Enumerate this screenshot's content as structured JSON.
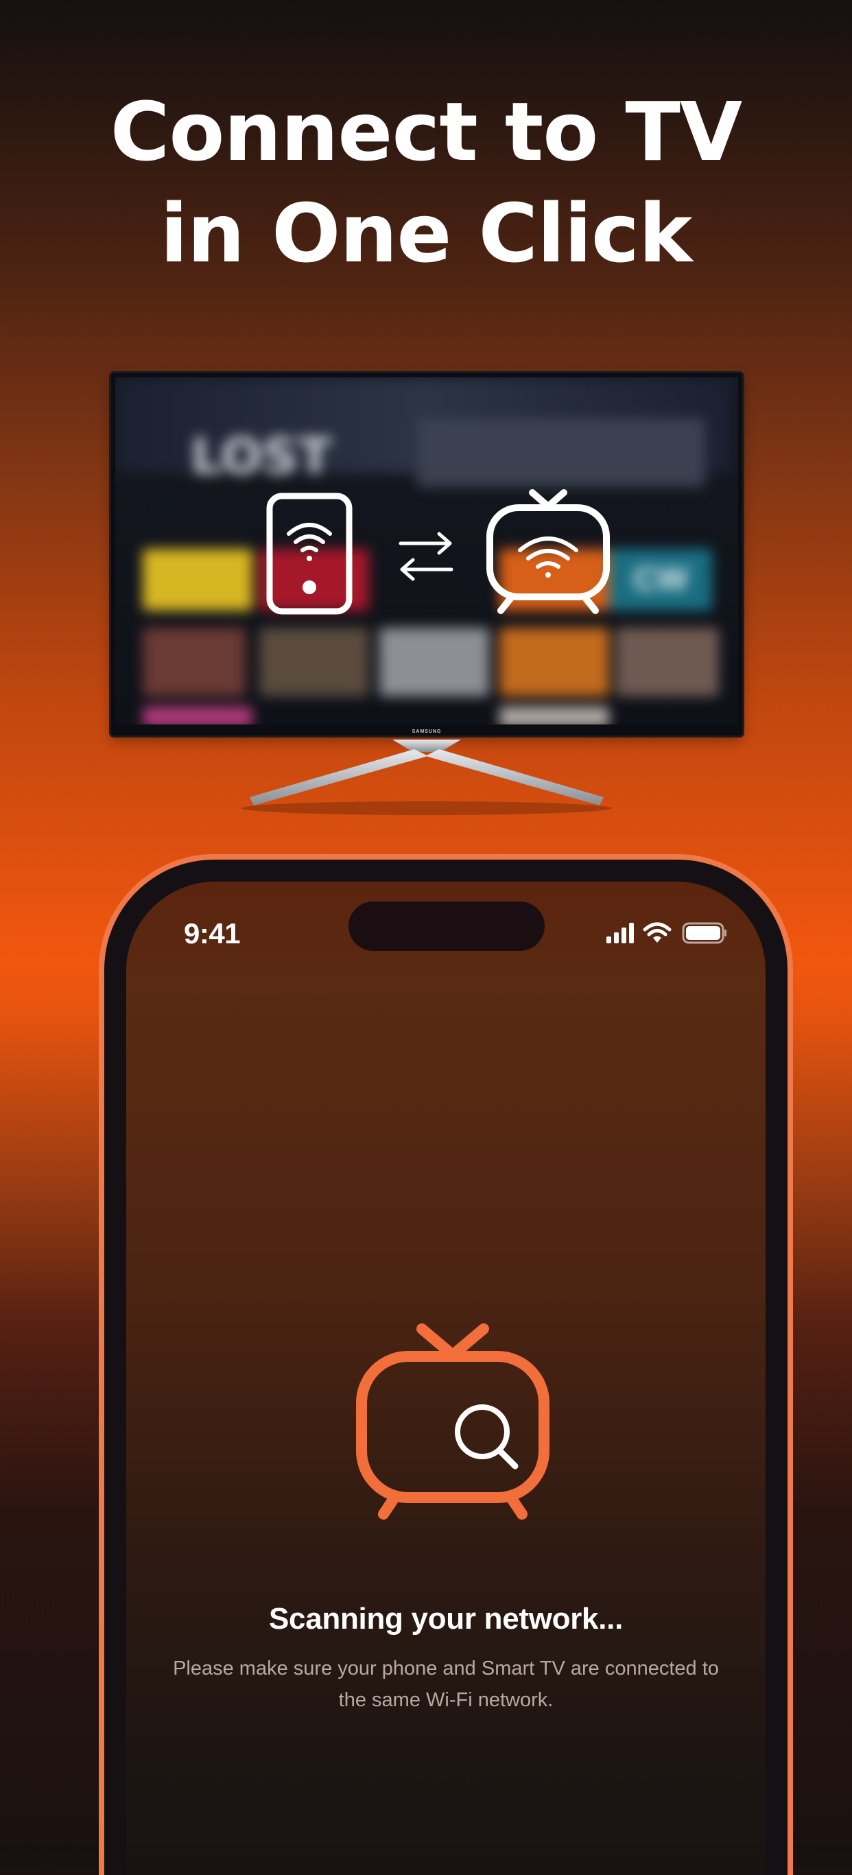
{
  "headline": {
    "line1": "Connect to TV",
    "line2": "in One Click"
  },
  "tv_promo": {
    "brand": "SAMSUNG",
    "blurred_show_title": "LOST",
    "blurred_channel_badge": "CW",
    "phone_icon": "phone-wifi-icon",
    "arrows_icon": "swap-arrows-icon",
    "tv_icon": "tv-wifi-icon"
  },
  "status_bar": {
    "time": "9:41",
    "signal_icon": "cellular-signal-icon",
    "wifi_icon": "wifi-icon",
    "battery_icon": "battery-icon"
  },
  "scanning": {
    "icon": "tv-search-icon",
    "title": "Scanning your network...",
    "description": "Please make sure your phone and Smart TV are connected to the same Wi-Fi network."
  },
  "colors": {
    "accent": "#F26F3C",
    "frame": "#F0794A",
    "text_primary": "#FFFFFF",
    "text_secondary": "#B7A9A2"
  }
}
